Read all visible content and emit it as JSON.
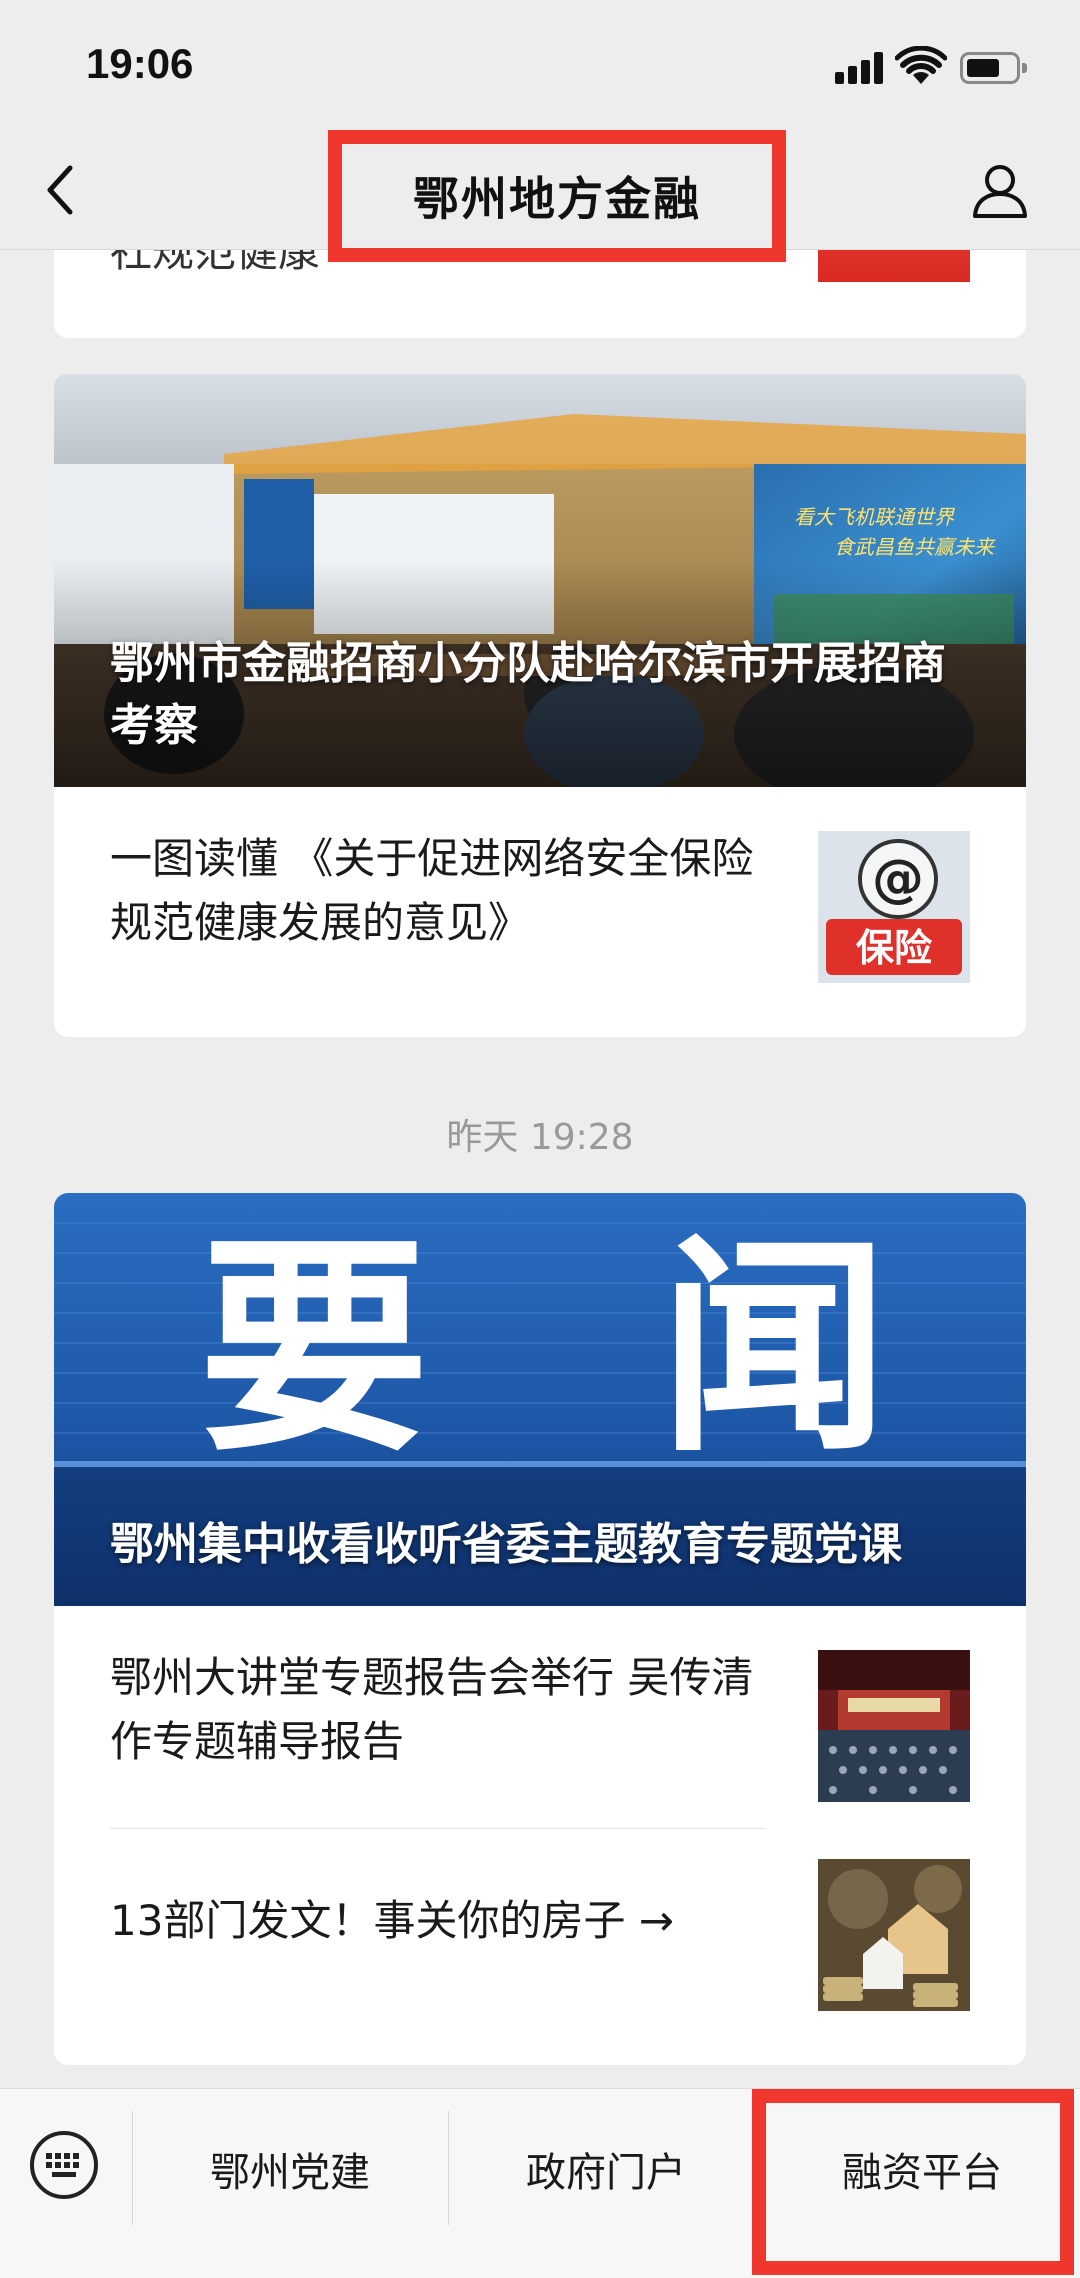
{
  "status": {
    "time": "19:06"
  },
  "nav": {
    "title": "鄂州地方金融"
  },
  "feed": {
    "prev_card_text": "社规范健康",
    "group1": {
      "hero_title": "鄂州市金融招商小分队赴哈尔滨市开展招商考察",
      "hero_banner_text": "看大飞机联通世界 食武昌鱼共赢未来",
      "items": [
        {
          "text": "一图读懂 《关于促进网络安全保险规范健康发展的意见》",
          "thumb_label": "保险",
          "thumb_symbol": "@"
        }
      ]
    },
    "timestamp": "昨天 19:28",
    "group2": {
      "hero_title": "鄂州集中收看收听省委主题教育专题党课",
      "hero_big_chars": [
        "要",
        "闻"
      ],
      "items": [
        {
          "text": "鄂州大讲堂专题报告会举行 吴传清作专题辅导报告"
        },
        {
          "text": "13部门发文！事关你的房子 →"
        }
      ]
    }
  },
  "menu": {
    "items": [
      "鄂州党建",
      "政府门户",
      "融资平台"
    ]
  },
  "colors": {
    "highlight": "#f0372d",
    "background": "#ededed"
  }
}
